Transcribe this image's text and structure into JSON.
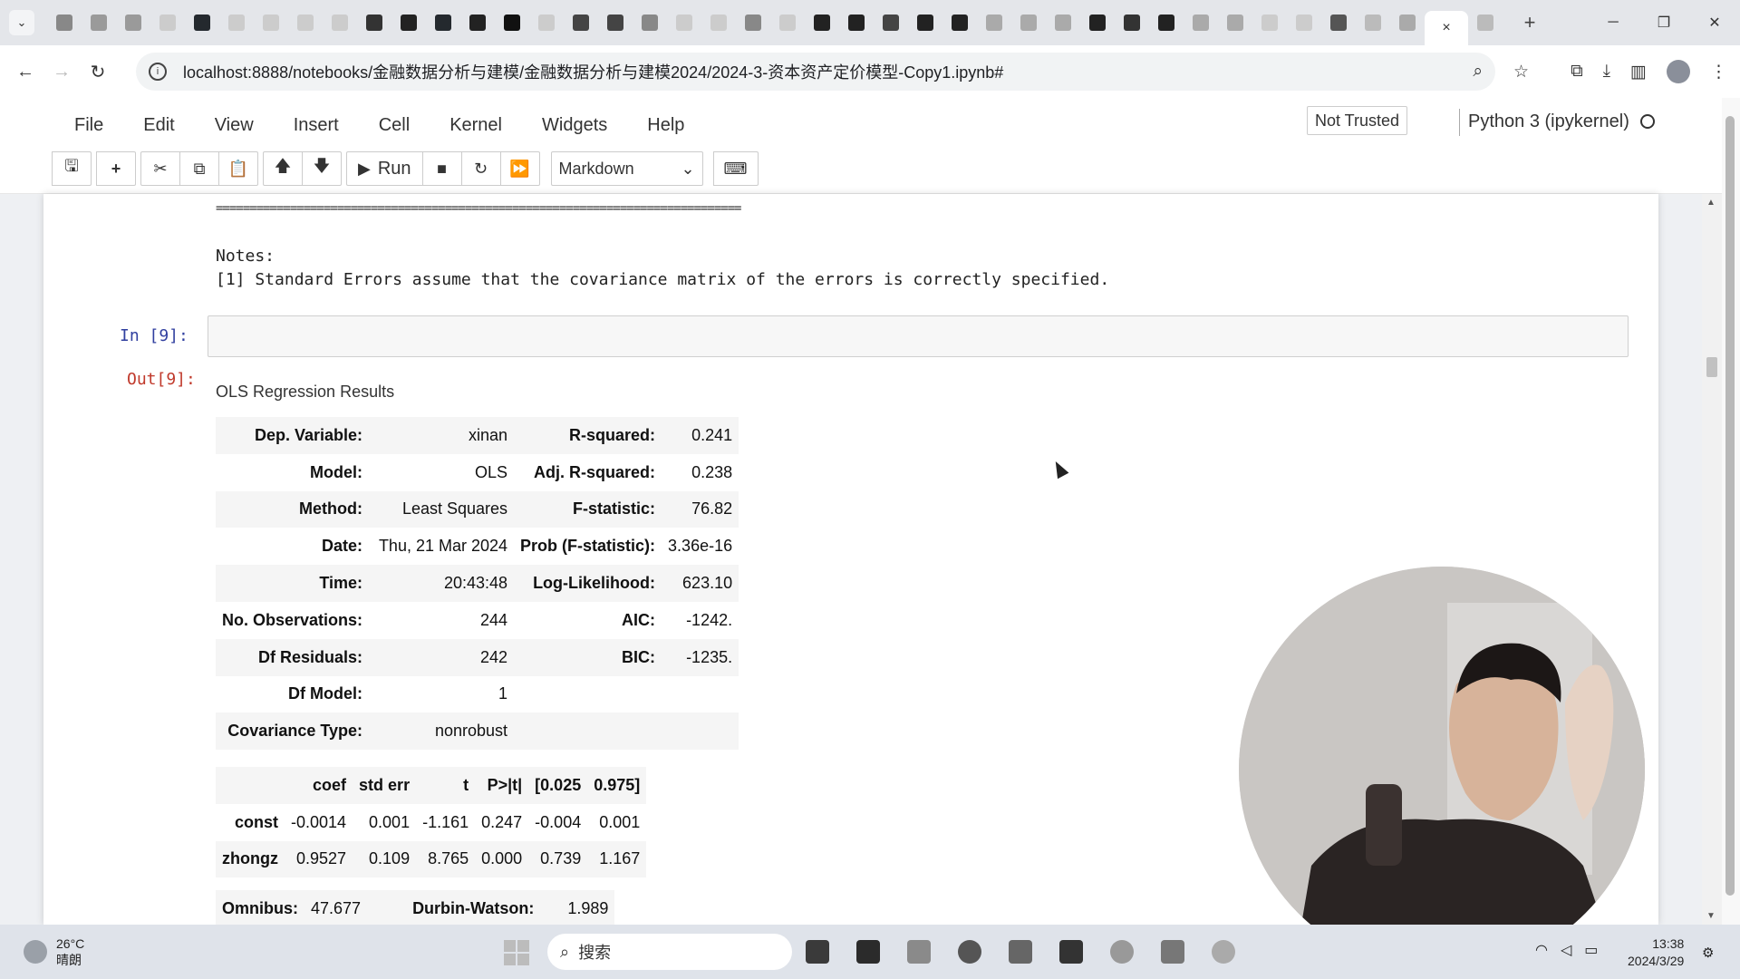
{
  "browser": {
    "tabs_menu_icon": "chevron-down-icon",
    "favicon_tabs": [
      {
        "icon": "tab-favicon",
        "color": "#888888"
      },
      {
        "icon": "tab-favicon",
        "color": "#9a9a9a"
      },
      {
        "icon": "tab-favicon",
        "color": "#9a9a9a"
      },
      {
        "icon": "tab-favicon",
        "color": "#cccccc"
      },
      {
        "icon": "github-icon",
        "color": "#24292e"
      },
      {
        "icon": "tab-favicon",
        "color": "#cccccc"
      },
      {
        "icon": "tab-favicon",
        "color": "#cccccc"
      },
      {
        "icon": "tab-favicon",
        "color": "#cccccc"
      },
      {
        "icon": "tab-favicon",
        "color": "#cccccc"
      },
      {
        "icon": "globe-icon",
        "color": "#333333"
      },
      {
        "icon": "tab-favicon",
        "color": "#222222"
      },
      {
        "icon": "github-icon",
        "color": "#24292e"
      },
      {
        "icon": "tab-favicon",
        "color": "#222222"
      },
      {
        "icon": "tab-favicon",
        "color": "#111111"
      },
      {
        "icon": "tab-favicon",
        "color": "#cccccc"
      },
      {
        "icon": "tab-favicon",
        "color": "#444444"
      },
      {
        "icon": "tab-favicon",
        "color": "#444444"
      },
      {
        "icon": "tab-favicon",
        "color": "#888888"
      },
      {
        "icon": "tab-favicon",
        "color": "#cccccc"
      },
      {
        "icon": "tab-favicon",
        "color": "#cccccc"
      },
      {
        "icon": "tab-favicon",
        "color": "#888888"
      },
      {
        "icon": "tab-favicon",
        "color": "#cccccc"
      },
      {
        "icon": "tab-favicon",
        "color": "#222222"
      },
      {
        "icon": "tab-favicon",
        "color": "#222222"
      },
      {
        "icon": "tab-favicon",
        "color": "#444444"
      },
      {
        "icon": "tab-favicon",
        "color": "#222222"
      },
      {
        "icon": "tab-favicon",
        "color": "#222222"
      },
      {
        "icon": "cloud-icon",
        "color": "#aaaaaa"
      },
      {
        "icon": "cloud-icon",
        "color": "#aaaaaa"
      },
      {
        "icon": "tab-favicon",
        "color": "#aaaaaa"
      },
      {
        "icon": "tab-favicon",
        "color": "#222222"
      },
      {
        "icon": "tab-favicon",
        "color": "#333333"
      },
      {
        "icon": "tab-favicon",
        "color": "#222222"
      },
      {
        "icon": "tab-favicon",
        "color": "#aaaaaa"
      },
      {
        "icon": "tab-favicon",
        "color": "#aaaaaa"
      },
      {
        "icon": "tab-favicon",
        "color": "#cccccc"
      },
      {
        "icon": "tab-favicon",
        "color": "#cccccc"
      },
      {
        "icon": "tab-favicon",
        "color": "#555555"
      },
      {
        "icon": "tab-favicon",
        "color": "#bbbbbb"
      },
      {
        "icon": "tab-favicon",
        "color": "#aaaaaa"
      }
    ],
    "active_tab_close": "×",
    "extra_tab_color": "#bbbbbb",
    "new_tab": "+",
    "url": "localhost:8888/notebooks/金融数据分析与建模/金融数据分析与建模2024/2024-3-资本资产定价模型-Copy1.ipynb#"
  },
  "jupyter": {
    "menu": [
      "File",
      "Edit",
      "View",
      "Insert",
      "Cell",
      "Kernel",
      "Widgets",
      "Help"
    ],
    "trust_status": "Not Trusted",
    "kernel": "Python 3 (ipykernel)",
    "toolbar": {
      "run_label": "Run",
      "cell_type": "Markdown"
    }
  },
  "notebook": {
    "separator": "==============================================================================",
    "notes_title": "Notes:",
    "notes_line": "[1] Standard Errors assume that the covariance matrix of the errors is correctly specified.",
    "in_prompt": "In  [9]:",
    "out_prompt": "Out[9]:",
    "output_title": "OLS Regression Results",
    "summary": [
      [
        "Dep. Variable:",
        "xinan",
        "R-squared:",
        "0.241"
      ],
      [
        "Model:",
        "OLS",
        "Adj. R-squared:",
        "0.238"
      ],
      [
        "Method:",
        "Least Squares",
        "F-statistic:",
        "76.82"
      ],
      [
        "Date:",
        "Thu, 21 Mar 2024",
        "Prob (F-statistic):",
        "3.36e-16"
      ],
      [
        "Time:",
        "20:43:48",
        "Log-Likelihood:",
        "623.10"
      ],
      [
        "No. Observations:",
        "244",
        "AIC:",
        "-1242."
      ],
      [
        "Df Residuals:",
        "242",
        "BIC:",
        "-1235."
      ],
      [
        "Df Model:",
        "1",
        "",
        ""
      ],
      [
        "Covariance Type:",
        "nonrobust",
        "",
        ""
      ]
    ],
    "coef_header": [
      "",
      "coef",
      "std err",
      "t",
      "P>|t|",
      "[0.025",
      "0.975]"
    ],
    "coef_rows": [
      [
        "const",
        "-0.0014",
        "0.001",
        "-1.161",
        "0.247",
        "-0.004",
        "0.001"
      ],
      [
        "zhongz",
        "0.9527",
        "0.109",
        "8.765",
        "0.000",
        "0.739",
        "1.167"
      ]
    ],
    "diag_rows": [
      [
        "Omnibus:",
        "47.677",
        "Durbin-Watson:",
        "1.989"
      ]
    ]
  },
  "taskbar": {
    "temperature": "26°C",
    "weather": "晴朗",
    "search_placeholder": "搜索",
    "time": "13:38",
    "date": "2024/3/29"
  }
}
